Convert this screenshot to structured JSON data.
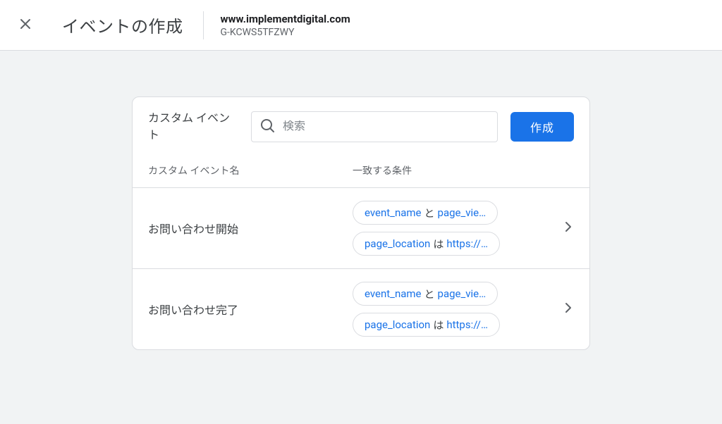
{
  "header": {
    "title": "イベントの作成",
    "site_url": "www.implementdigital.com",
    "site_id": "G-KCWS5TFZWY"
  },
  "card": {
    "section_label": "カスタム イベント",
    "search_placeholder": "検索",
    "create_button_label": "作成",
    "columns": {
      "name": "カスタム イベント名",
      "conditions": "一致する条件"
    }
  },
  "events": [
    {
      "name": "お問い合わせ開始",
      "conditions": [
        {
          "key": "event_name",
          "op": "と",
          "value": "page_vie…"
        },
        {
          "key": "page_location",
          "op": "は",
          "value": "https://…"
        }
      ]
    },
    {
      "name": "お問い合わせ完了",
      "conditions": [
        {
          "key": "event_name",
          "op": "と",
          "value": "page_vie…"
        },
        {
          "key": "page_location",
          "op": "は",
          "value": "https://…"
        }
      ]
    }
  ]
}
